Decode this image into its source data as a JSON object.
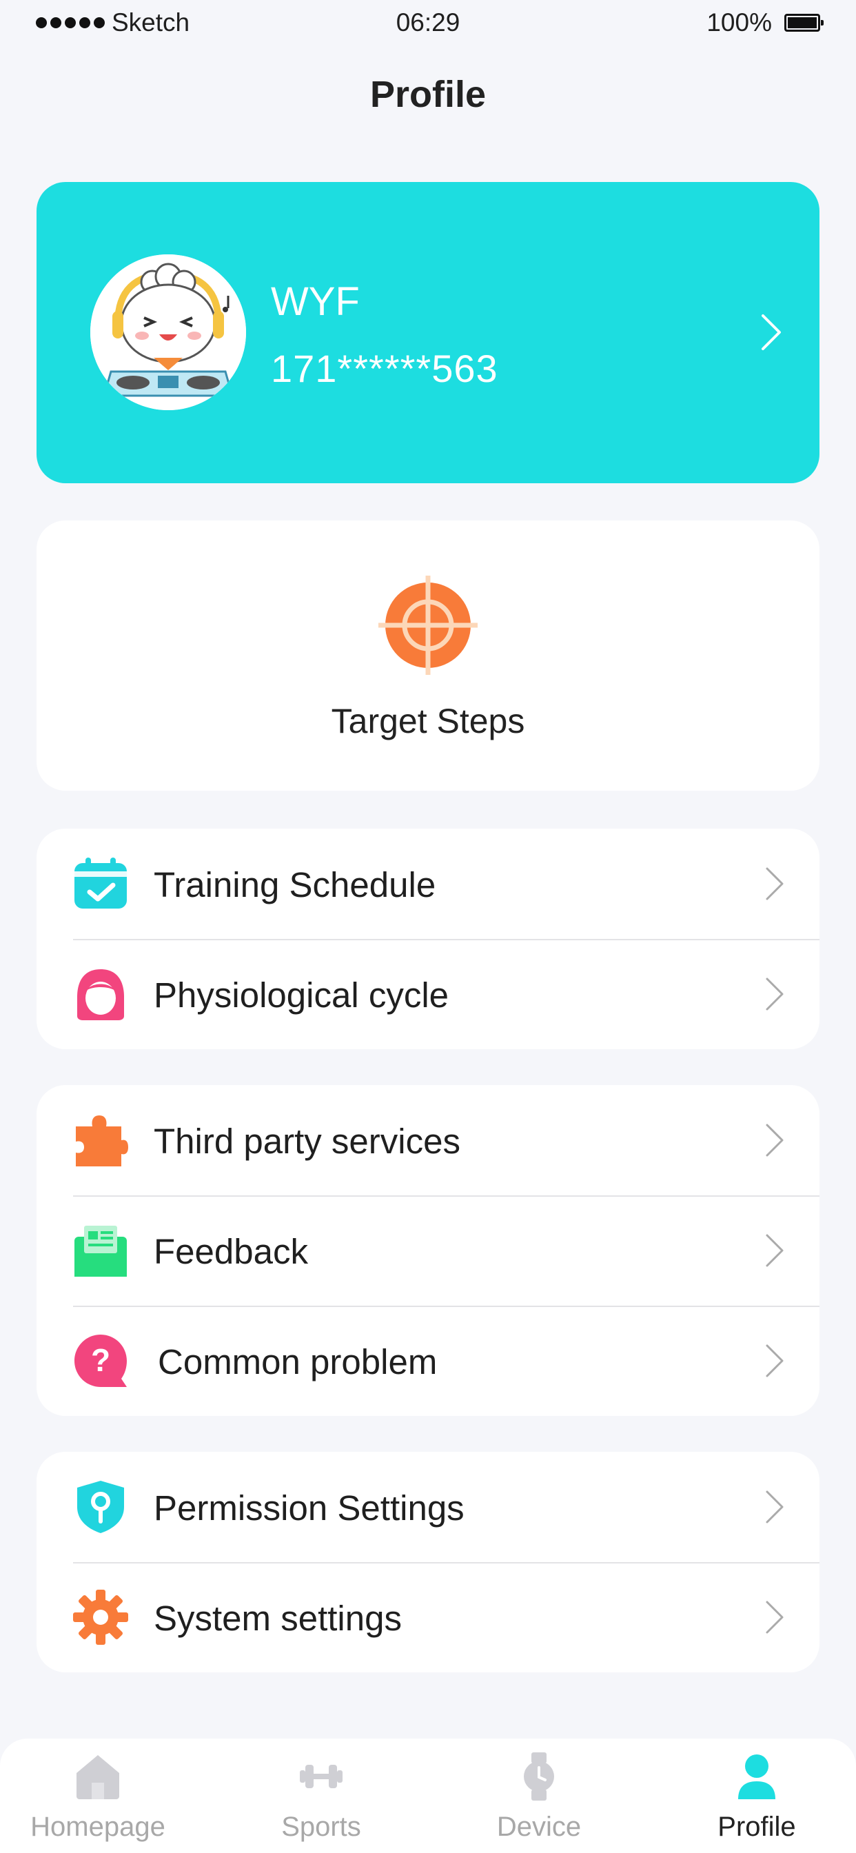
{
  "status_bar": {
    "carrier": "Sketch",
    "time": "06:29",
    "battery": "100%"
  },
  "page": {
    "title": "Profile"
  },
  "profile": {
    "name": "WYF",
    "phone": "171******563"
  },
  "target": {
    "label": "Target Steps"
  },
  "menu": {
    "group1": [
      {
        "label": "Training Schedule",
        "icon": "calendar-check-icon",
        "color": "#21d4de"
      },
      {
        "label": "Physiological cycle",
        "icon": "woman-face-icon",
        "color": "#f2457e"
      }
    ],
    "group2": [
      {
        "label": "Third party services",
        "icon": "puzzle-icon",
        "color": "#f87b39"
      },
      {
        "label": "Feedback",
        "icon": "mail-icon",
        "color": "#26dd7e"
      },
      {
        "label": "Common problem",
        "icon": "question-icon",
        "color": "#f2457e"
      }
    ],
    "group3": [
      {
        "label": "Permission Settings",
        "icon": "shield-key-icon",
        "color": "#21d4de"
      },
      {
        "label": "System settings",
        "icon": "gear-icon",
        "color": "#f87b39"
      }
    ]
  },
  "tabs": [
    {
      "label": "Homepage",
      "icon": "home-icon",
      "active": false
    },
    {
      "label": "Sports",
      "icon": "dumbbell-icon",
      "active": false
    },
    {
      "label": "Device",
      "icon": "watch-icon",
      "active": false
    },
    {
      "label": "Profile",
      "icon": "person-icon",
      "active": true
    }
  ],
  "colors": {
    "accent": "#1ddde0",
    "background": "#f5f6fa",
    "target": "#f87b39"
  }
}
